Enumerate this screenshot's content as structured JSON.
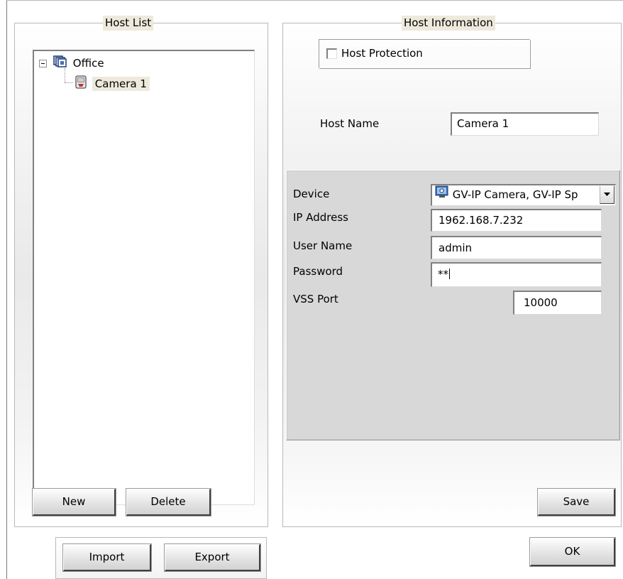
{
  "host_list": {
    "title": "Host List",
    "tree": {
      "root": {
        "label": "Office",
        "icon": "folder-group-icon",
        "expanded": true
      },
      "children": [
        {
          "label": "Camera 1",
          "icon": "camera-icon",
          "selected": true
        }
      ]
    },
    "new_label": "New",
    "delete_label": "Delete"
  },
  "import_label": "Import",
  "export_label": "Export",
  "host_info": {
    "title": "Host Information",
    "host_protection_label": "Host Protection",
    "host_protection_checked": false,
    "host_name_label": "Host Name",
    "host_name_value": "Camera 1",
    "device_label": "Device",
    "device_value": "GV-IP Camera, GV-IP Sp",
    "device_icon": "device-camera-icon",
    "ip_label": "IP Address",
    "ip_value": "1962.168.7.232",
    "user_label": "User Name",
    "user_value": "admin",
    "password_label": "Password",
    "password_value": "**",
    "vss_port_label": "VSS Port",
    "vss_port_value": "10000",
    "save_label": "Save"
  },
  "ok_label": "OK",
  "colors": {
    "legend_bg": "#ede9dc",
    "selected_bg": "#ede9dc",
    "panel_bg": "#d8d8d8"
  }
}
